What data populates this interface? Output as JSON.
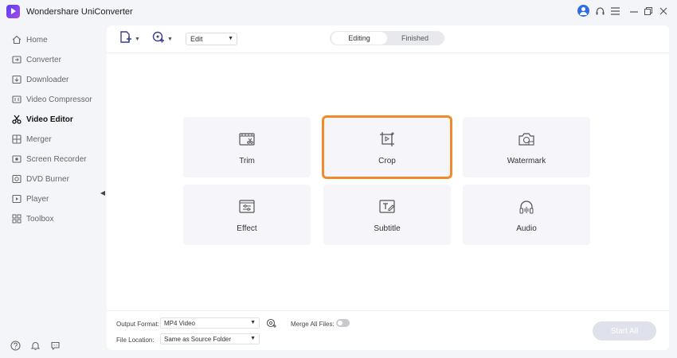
{
  "window": {
    "title": "Wondershare UniConverter"
  },
  "sidebar": {
    "items": [
      {
        "label": "Home",
        "icon": "home-icon"
      },
      {
        "label": "Converter",
        "icon": "converter-icon"
      },
      {
        "label": "Downloader",
        "icon": "downloader-icon"
      },
      {
        "label": "Video Compressor",
        "icon": "compressor-icon"
      },
      {
        "label": "Video Editor",
        "icon": "scissors-icon"
      },
      {
        "label": "Merger",
        "icon": "merger-icon"
      },
      {
        "label": "Screen Recorder",
        "icon": "screen-recorder-icon"
      },
      {
        "label": "DVD Burner",
        "icon": "dvd-icon"
      },
      {
        "label": "Player",
        "icon": "player-icon"
      },
      {
        "label": "Toolbox",
        "icon": "toolbox-icon"
      }
    ],
    "active": "Video Editor"
  },
  "toolbar": {
    "mode_select": "Edit",
    "tabs": [
      {
        "label": "Editing",
        "active": true
      },
      {
        "label": "Finished",
        "active": false
      }
    ]
  },
  "tools": [
    {
      "label": "Trim",
      "icon": "trim-icon"
    },
    {
      "label": "Crop",
      "icon": "crop-icon",
      "highlighted": true
    },
    {
      "label": "Watermark",
      "icon": "watermark-icon"
    },
    {
      "label": "Effect",
      "icon": "effect-icon"
    },
    {
      "label": "Subtitle",
      "icon": "subtitle-icon"
    },
    {
      "label": "Audio",
      "icon": "audio-icon"
    }
  ],
  "footer": {
    "output_format_label": "Output Format:",
    "output_format_value": "MP4 Video",
    "merge_label": "Merge All Files:",
    "merge_enabled": false,
    "file_location_label": "File Location:",
    "file_location_value": "Same as Source Folder",
    "start_label": "Start All"
  },
  "colors": {
    "highlight": "#f08a2c",
    "accent": "#2f6ce6"
  }
}
